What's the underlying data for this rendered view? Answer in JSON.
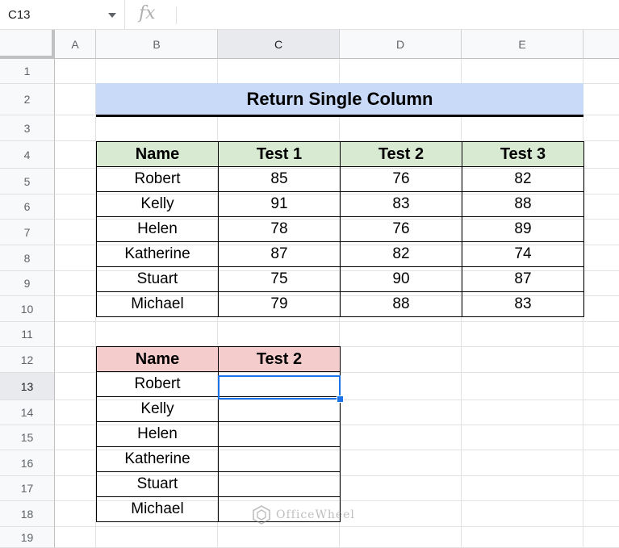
{
  "name_box": "C13",
  "fx_label": "fx",
  "columns": [
    "A",
    "B",
    "C",
    "D",
    "E"
  ],
  "selected_column": "C",
  "rows": [
    "1",
    "2",
    "3",
    "4",
    "5",
    "6",
    "7",
    "8",
    "9",
    "10",
    "11",
    "12",
    "13",
    "14",
    "15",
    "16",
    "17",
    "18",
    "19"
  ],
  "selected_row": "13",
  "title": "Return Single Column",
  "table1": {
    "headers": [
      "Name",
      "Test 1",
      "Test 2",
      "Test 3"
    ],
    "rows": [
      [
        "Robert",
        "85",
        "76",
        "82"
      ],
      [
        "Kelly",
        "91",
        "83",
        "88"
      ],
      [
        "Helen",
        "78",
        "76",
        "89"
      ],
      [
        "Katherine",
        "87",
        "82",
        "74"
      ],
      [
        "Stuart",
        "75",
        "90",
        "87"
      ],
      [
        "Michael",
        "79",
        "88",
        "83"
      ]
    ]
  },
  "table2": {
    "headers": [
      "Name",
      "Test 2"
    ],
    "rows": [
      [
        "Robert",
        ""
      ],
      [
        "Kelly",
        ""
      ],
      [
        "Helen",
        ""
      ],
      [
        "Katherine",
        ""
      ],
      [
        "Stuart",
        ""
      ],
      [
        "Michael",
        ""
      ]
    ]
  },
  "watermark": "OfficeWheel",
  "colors": {
    "title_bg": "#c9daf8",
    "table1_header_bg": "#d9ead3",
    "table2_header_bg": "#f4cccc",
    "selection": "#1a73e8"
  }
}
